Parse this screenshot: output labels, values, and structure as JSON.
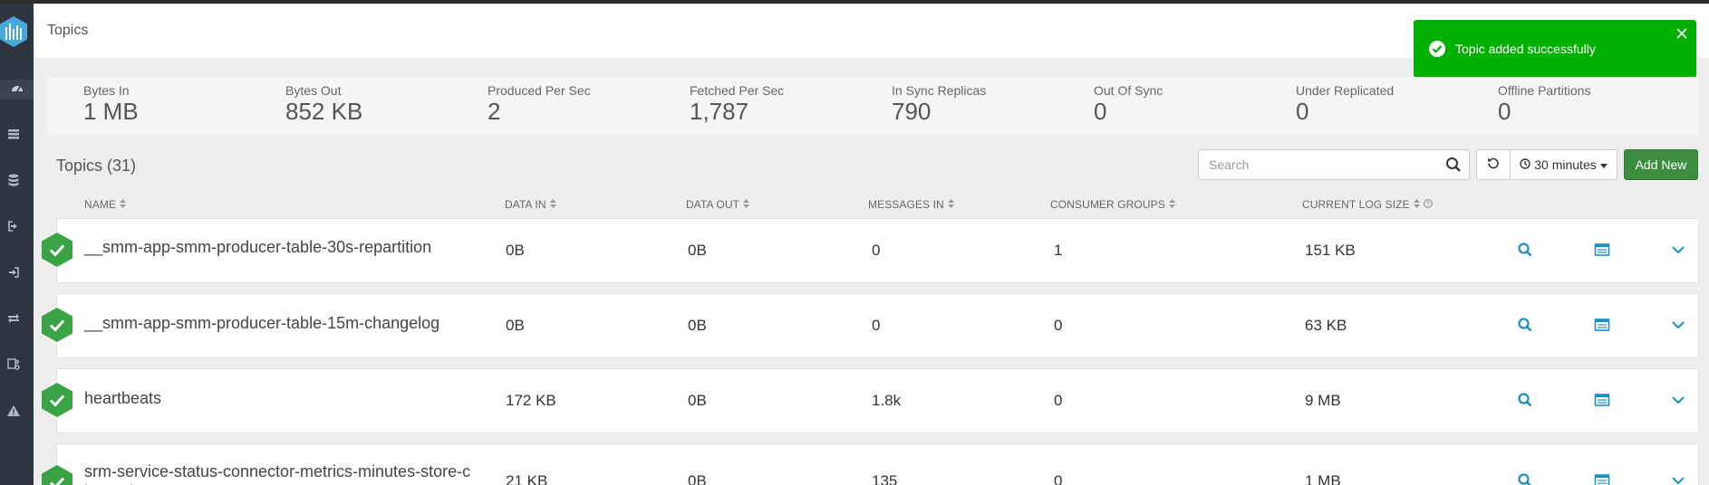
{
  "header": {
    "title": "Topics"
  },
  "toast": {
    "message": "Topic added successfully"
  },
  "stats": [
    {
      "label": "Bytes In",
      "value": "1 MB"
    },
    {
      "label": "Bytes Out",
      "value": "852 KB"
    },
    {
      "label": "Produced Per Sec",
      "value": "2"
    },
    {
      "label": "Fetched Per Sec",
      "value": "1,787"
    },
    {
      "label": "In Sync Replicas",
      "value": "790"
    },
    {
      "label": "Out Of Sync",
      "value": "0"
    },
    {
      "label": "Under Replicated",
      "value": "0"
    },
    {
      "label": "Offline Partitions",
      "value": "0"
    }
  ],
  "topics_list": {
    "title": "Topics (31)",
    "search_placeholder": "Search",
    "time_range": "30 minutes",
    "add_new_label": "Add New"
  },
  "columns": [
    "NAME",
    "DATA IN",
    "DATA OUT",
    "MESSAGES IN",
    "CONSUMER GROUPS",
    "CURRENT LOG SIZE"
  ],
  "topics": [
    {
      "name": "__smm-app-smm-producer-table-30s-repartition",
      "data_in": "0B",
      "data_out": "0B",
      "messages_in": "0",
      "consumer_groups": "1",
      "log_size": "151 KB"
    },
    {
      "name": "__smm-app-smm-producer-table-15m-changelog",
      "data_in": "0B",
      "data_out": "0B",
      "messages_in": "0",
      "consumer_groups": "0",
      "log_size": "63 KB"
    },
    {
      "name": "heartbeats",
      "data_in": "172 KB",
      "data_out": "0B",
      "messages_in": "1.8k",
      "consumer_groups": "0",
      "log_size": "9 MB"
    },
    {
      "name": "srm-service-status-connector-metrics-minutes-store-c hangelog",
      "data_in": "21 KB",
      "data_out": "0B",
      "messages_in": "135",
      "consumer_groups": "0",
      "log_size": "1 MB"
    }
  ],
  "colors": {
    "sidebar": "#2e3440",
    "toast": "#00b000",
    "add_button": "#3c8d3f",
    "status_ok": "#3aa345",
    "link_icon": "#1a8fc6"
  },
  "icons": {
    "sidebar": [
      "logo-icon",
      "dashboard-icon",
      "brokers-icon",
      "topics-icon",
      "producers-icon",
      "consumers-icon",
      "replication-icon",
      "schema-icon",
      "alerts-icon"
    ],
    "row": [
      "search-icon",
      "data-explorer-icon",
      "chevron-down-icon"
    ]
  }
}
